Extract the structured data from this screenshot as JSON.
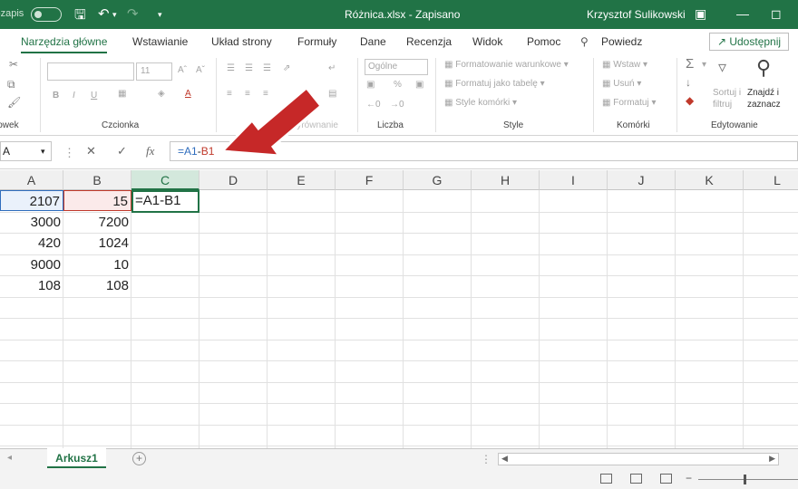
{
  "titlebar": {
    "autosave_label": "Autozapis",
    "doc_title": "Różnica.xlsx  -  Zapisano",
    "user": "Krzysztof Sulikowski"
  },
  "tabs": [
    "Narzędzia główne",
    "Wstawianie",
    "Układ strony",
    "Formuły",
    "Dane",
    "Recenzja",
    "Widok",
    "Pomoc"
  ],
  "search_label": "Powiedz",
  "share_label": "Udostępnij",
  "ribbon": {
    "groups": [
      "Schowek",
      "Czcionka",
      "Wyrównanie",
      "Liczba",
      "Style",
      "Komórki",
      "Edytowanie"
    ],
    "font_size": "11",
    "number_format": "Ogólne",
    "styles": [
      "Formatowanie warunkowe",
      "Formatuj jako tabelę",
      "Style komórki"
    ],
    "cells": [
      "Wstaw",
      "Usuń",
      "Formatuj"
    ],
    "edit": [
      "Sortuj i filtruj",
      "Znajdź i zaznacz"
    ]
  },
  "formula_bar": {
    "name_box": "A",
    "formula_prefix": "=A1",
    "formula_op": "-",
    "formula_ref": "B1"
  },
  "columns": [
    "A",
    "B",
    "C",
    "D",
    "E",
    "F",
    "G",
    "H",
    "I",
    "J",
    "K",
    "L"
  ],
  "rows": [
    [
      "2107",
      "15",
      "=A1-B1"
    ],
    [
      "3000",
      "7200",
      ""
    ],
    [
      "420",
      "1024",
      ""
    ],
    [
      "9000",
      "10",
      ""
    ],
    [
      "108",
      "108",
      ""
    ]
  ],
  "sheet_name": "Arkusz1",
  "colors": {
    "accent": "#217346",
    "ref_a": "#2f6dbd",
    "ref_b": "#c0392b",
    "arrow": "#c62828"
  }
}
